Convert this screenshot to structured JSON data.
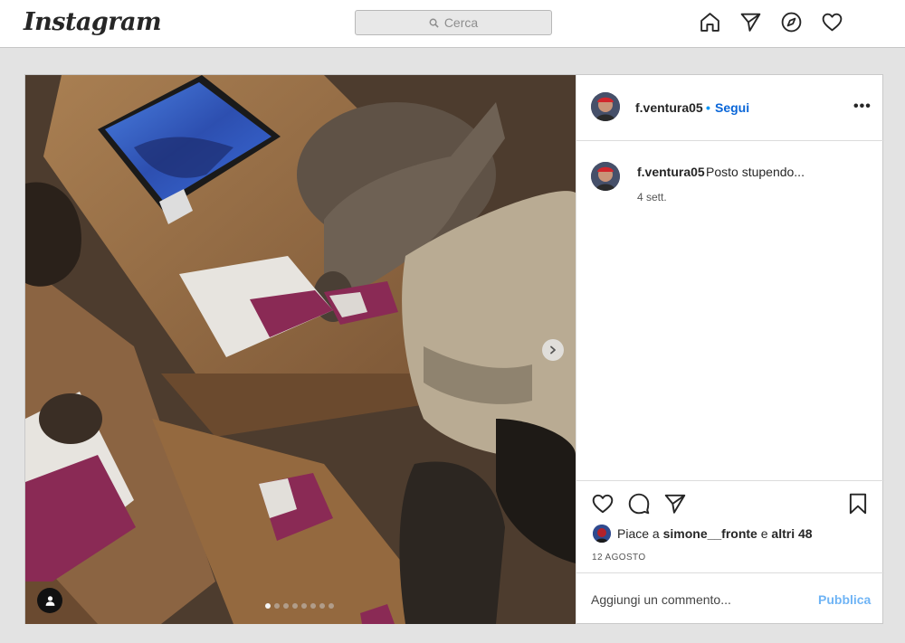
{
  "app": {
    "logo_text": "Instagram"
  },
  "search": {
    "placeholder": "Cerca",
    "icon": "search-icon"
  },
  "nav": {
    "icons": [
      "home-icon",
      "direct-message-icon",
      "explore-compass-icon",
      "activity-heart-icon"
    ]
  },
  "post": {
    "author": "f.ventura05",
    "separator": "•",
    "follow_label": "Segui",
    "more_label": "•••",
    "caption_author": "f.ventura05",
    "caption_text": "Posto stupendo...",
    "caption_time": "4 sett.",
    "likes_prefix": "Piace a ",
    "likes_user": "simone__fronte",
    "likes_joiner": " e ",
    "likes_others": "altri 48",
    "date": "12 AGOSTO",
    "comment_placeholder": "Aggiungi un commento...",
    "publish_label": "Pubblica",
    "carousel": {
      "total": 8,
      "active": 1
    }
  },
  "colors": {
    "link_blue": "#0a66d8",
    "publish_blue": "#6fb4f5",
    "page_bg": "#e3e3e3"
  }
}
